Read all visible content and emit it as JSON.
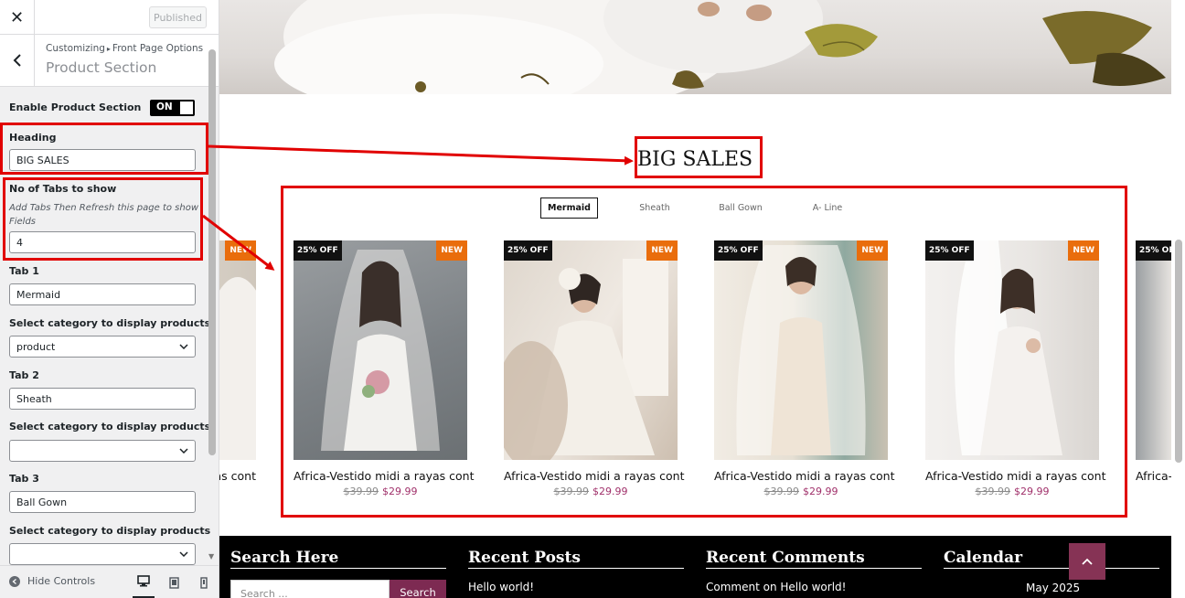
{
  "sidebar": {
    "close_icon": "close-icon",
    "published_label": "Published",
    "breadcrumb": {
      "root": "Customizing",
      "separator": "▸",
      "current": "Front Page Options"
    },
    "section_title": "Product Section",
    "enable_label": "Enable Product Section",
    "enable_toggle": "ON",
    "heading_label": "Heading",
    "heading_value": "BIG SALES",
    "tabs_count_label": "No of Tabs to show",
    "tabs_count_desc": "Add Tabs Then Refresh this page to show Fields",
    "tabs_count_value": "4",
    "tab1_label": "Tab 1",
    "tab1_value": "Mermaid",
    "cat_label": "Select category to display products",
    "cat1_value": "product",
    "tab2_label": "Tab 2",
    "tab2_value": "Sheath",
    "cat2_value": "",
    "tab3_label": "Tab 3",
    "tab3_value": "Ball Gown",
    "cat3_value": "",
    "hide_controls": "Hide Controls"
  },
  "preview": {
    "heading": "BIG SALES",
    "tabs": [
      "Mermaid",
      "Sheath",
      "Ball Gown",
      "A- Line"
    ],
    "active_tab": "Mermaid",
    "products": [
      {
        "discount": "25% OFF",
        "badge": "NEW",
        "name": "Africa-Vestido midi a rayas cont",
        "old_price": "$39.99",
        "price": "$29.99"
      },
      {
        "discount": "25% OFF",
        "badge": "NEW",
        "name": "Africa-Vestido midi a rayas cont",
        "old_price": "$39.99",
        "price": "$29.99"
      },
      {
        "discount": "25% OFF",
        "badge": "NEW",
        "name": "Africa-Vestido midi a rayas cont",
        "old_price": "$39.99",
        "price": "$29.99"
      },
      {
        "discount": "25% OFF",
        "badge": "NEW",
        "name": "Africa-Vestido midi a rayas cont",
        "old_price": "$39.99",
        "price": "$29.99"
      }
    ],
    "partial_left": {
      "badge": "NEW",
      "name": "as cont"
    },
    "partial_right": {
      "discount": "25% OF",
      "name": "Africa-"
    },
    "footer": {
      "search_title": "Search Here",
      "search_placeholder": "Search ...",
      "search_button": "Search",
      "posts_title": "Recent Posts",
      "post_1": "Hello world!",
      "comments_title": "Recent Comments",
      "comment_1": "Comment on Hello world!",
      "calendar_title": "Calendar",
      "calendar_month": "May 2025"
    }
  },
  "colors": {
    "accent_red": "#e10000",
    "badge_new": "#e96d0c",
    "price": "#a0306a",
    "search_button": "#7d2a52"
  }
}
